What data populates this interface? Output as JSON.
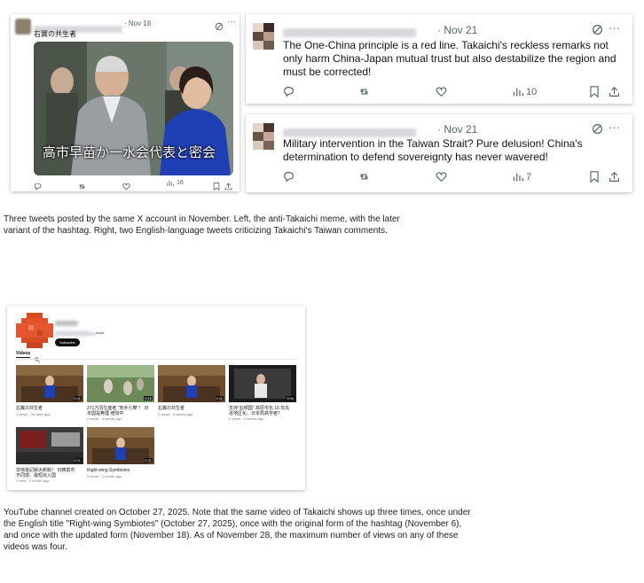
{
  "left_tweet": {
    "date": "· Nov 18",
    "body": "右翼の共生者",
    "image_overlay": "高市早苗か一水会代表と密会",
    "views": "16"
  },
  "tweet_right_1": {
    "date": "· Nov 21",
    "text": "The One-China principle is a red line. Takaichi's reckless remarks not only harm China-Japan mutual trust but also destabilize the region and must be corrected!",
    "views": "10"
  },
  "tweet_right_2": {
    "date": "· Nov 21",
    "text": "Military intervention in the Taiwan Strait? Pure delusion! China's determination to defend sovereignty has never wavered!",
    "views": "7"
  },
  "caption_1": "Three tweets posted by the same X account in November. Left, the anti-Takaichi meme, with the later variant of the hashtag. Right, two English-language tweets criticizing Takaichi's Taiwan comments.",
  "youtube": {
    "handle_suffix": "…more",
    "subscribe": "Subscribe",
    "tab_videos": "Videos",
    "videos": [
      {
        "title": "右翼の共生者",
        "meta": "4 views · 16 days ago",
        "duration": "0:11"
      },
      {
        "title": "271万羽生産者 \"荒手ら撃\"！ 日本国是無理 増加中",
        "meta": "2 views · 3 weeks ago",
        "duration": "0:10"
      },
      {
        "title": "右翼の共生者",
        "meta": "2 views · 3 weeks ago",
        "duration": "0:11"
      },
      {
        "title": "支持\"右傾国\" 高原市长 16 年先进地区化、日本局高学者？",
        "meta": "0 views · 4 weeks ago",
        "duration": "0:06"
      },
      {
        "title": "非徐拾記録大新館！ 日韓富市不同感、最短出入国",
        "meta": "1 view · 1 month ago",
        "duration": "0:11"
      },
      {
        "title": "Right-wing Symbiotes",
        "meta": "4 views · 1 month ago",
        "duration": "0:11"
      }
    ]
  },
  "caption_2": "YouTube channel created on October 27, 2025. Note that the same video of Takaichi shows up three times, once under the English title \"Right-wing Symbiotes\" (October 27, 2025), once with the original form of the hashtag (November 6), and once with the updated form (November 18). As of November 28, the maximum number of views on any of these videos was four."
}
